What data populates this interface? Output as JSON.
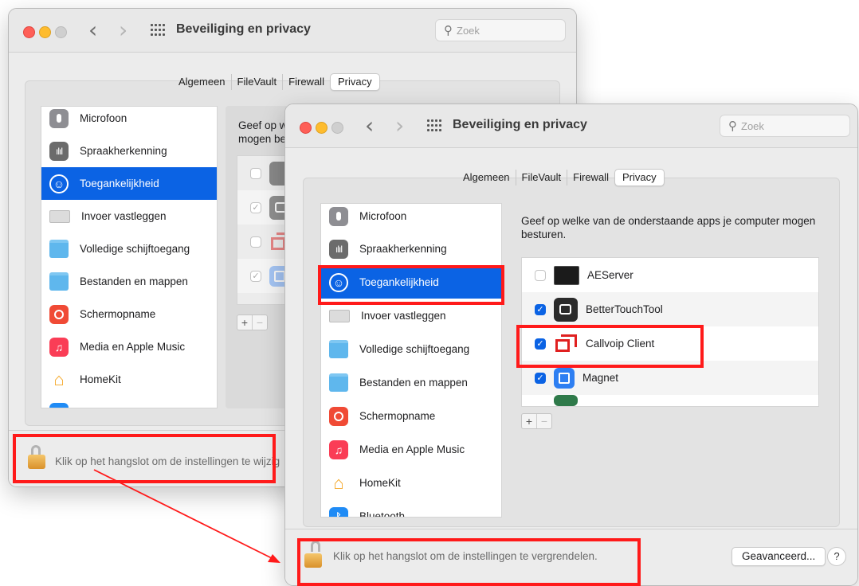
{
  "window": {
    "title": "Beveiliging en privacy",
    "search_placeholder": "Zoek"
  },
  "tabs": [
    "Algemeen",
    "FileVault",
    "Firewall",
    "Privacy"
  ],
  "selected_tab": "Privacy",
  "sidebar": {
    "items": [
      {
        "label": "Microfoon",
        "icon": "microphone-icon"
      },
      {
        "label": "Spraakherkenning",
        "icon": "speech-recognition-icon"
      },
      {
        "label": "Toegankelijkheid",
        "icon": "accessibility-icon"
      },
      {
        "label": "Invoer vastleggen",
        "icon": "keyboard-icon"
      },
      {
        "label": "Volledige schijftoegang",
        "icon": "folder-icon"
      },
      {
        "label": "Bestanden en mappen",
        "icon": "folder-icon"
      },
      {
        "label": "Schermopname",
        "icon": "screen-recording-icon"
      },
      {
        "label": "Media en Apple Music",
        "icon": "music-icon"
      },
      {
        "label": "HomeKit",
        "icon": "home-icon"
      },
      {
        "label": "Bluetooth",
        "icon": "bluetooth-icon"
      }
    ],
    "selected": "Toegankelijkheid"
  },
  "front": {
    "prompt": "Geef op welke van de onderstaande apps je computer mogen besturen.",
    "apps": [
      {
        "name": "AEServer",
        "checked": false,
        "icon": "terminal-app-icon"
      },
      {
        "name": "BetterTouchTool",
        "checked": true,
        "icon": "bettertouchtool-icon"
      },
      {
        "name": "Callvoip Client",
        "checked": true,
        "icon": "callvoip-icon"
      },
      {
        "name": "Magnet",
        "checked": true,
        "icon": "magnet-icon"
      }
    ],
    "lock_text": "Klik op het hangslot om de instellingen te vergrendelen.",
    "advanced_button": "Geavanceerd...",
    "help_button": "?"
  },
  "back": {
    "prompt": "Geef op w\nmogen be",
    "lock_text": "Klik op het hangslot om de instellingen te wijzig"
  },
  "plus": "+",
  "minus": "−",
  "annotation_color": "#ff1a1a"
}
